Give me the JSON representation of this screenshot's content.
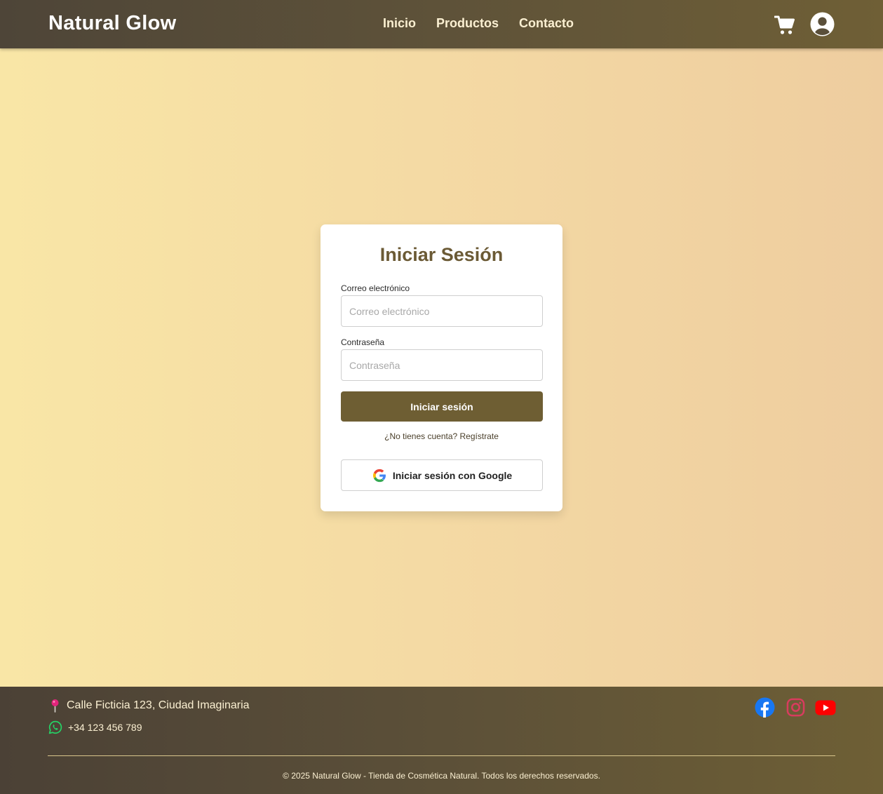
{
  "header": {
    "brand": "Natural Glow",
    "nav": [
      "Inicio",
      "Productos",
      "Contacto"
    ],
    "icons": [
      "cart-icon",
      "user-circle-icon"
    ]
  },
  "login": {
    "title": "Iniciar Sesión",
    "email_label": "Correo electrónico",
    "email_placeholder": "Correo electrónico",
    "email_value": "",
    "password_label": "Contraseña",
    "password_placeholder": "Contraseña",
    "password_value": "",
    "submit_label": "Iniciar sesión",
    "register_text": "¿No tienes cuenta? Regístrate",
    "google_label": "Iniciar sesión con Google"
  },
  "footer": {
    "address": "Calle Ficticia 123, Ciudad Imaginaria",
    "phone": "+34 123 456 789",
    "social": [
      "facebook-icon",
      "instagram-icon",
      "youtube-icon"
    ],
    "copyright": "© 2025 Natural Glow - Tienda de Cosmética Natural. Todos los derechos reservados."
  },
  "colors": {
    "header_bg": "#5a4f3a",
    "primary_button": "#6e5e33",
    "title": "#6b5a35",
    "nav_text": "#fbf0d2",
    "page_gradient_start": "#f9e6a6",
    "page_gradient_end": "#eecd9f"
  }
}
